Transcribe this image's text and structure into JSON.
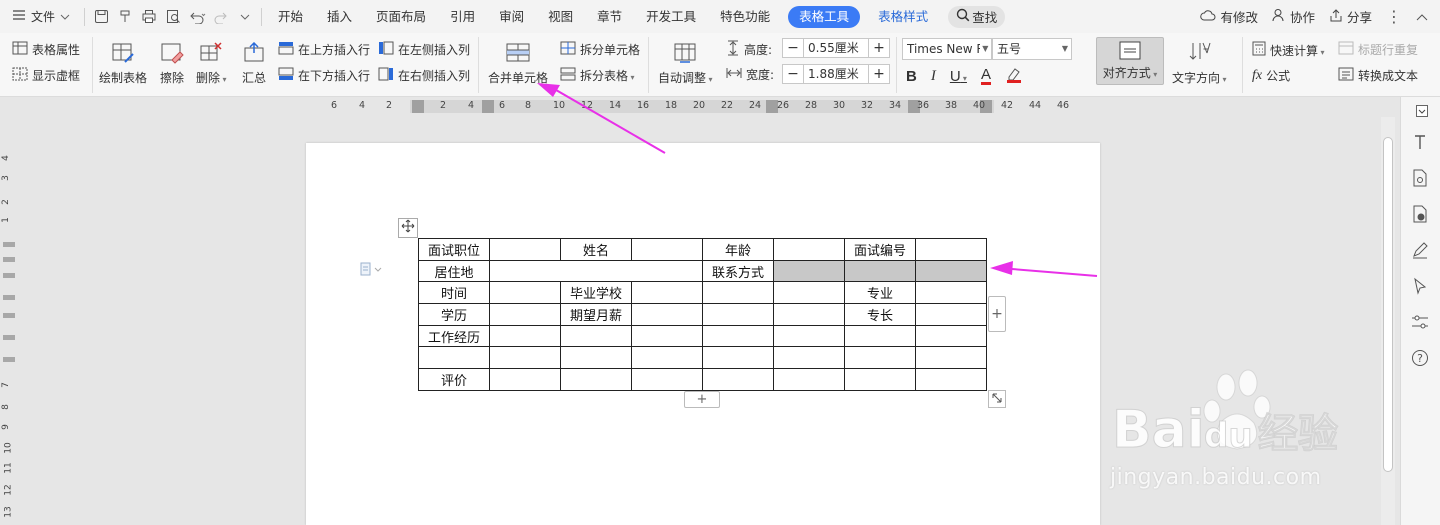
{
  "menubar": {
    "file_label": "文件",
    "tabs": [
      "开始",
      "插入",
      "页面布局",
      "引用",
      "审阅",
      "视图",
      "章节",
      "开发工具",
      "特色功能"
    ],
    "active_tab": "表格工具",
    "tab_style": "表格样式",
    "search_label": "查找",
    "right": {
      "modified": "有修改",
      "collab": "协作",
      "share": "分享"
    }
  },
  "ribbon": {
    "table_props": "表格属性",
    "show_grid": "显示虚框",
    "draw_table": "绘制表格",
    "erase": "擦除",
    "delete": "删除",
    "summary": "汇总",
    "insert_above": "在上方插入行",
    "insert_below": "在下方插入行",
    "insert_left": "在左侧插入列",
    "insert_right": "在右侧插入列",
    "merge_cells": "合并单元格",
    "split_cells": "拆分单元格",
    "split_table": "拆分表格",
    "auto_adjust": "自动调整",
    "height_label": "高度:",
    "height_value": "0.55厘米",
    "width_label": "宽度:",
    "width_value": "1.88厘米",
    "font_name": "Times New R",
    "font_size": "五号",
    "align": "对齐方式",
    "text_direction": "文字方向",
    "quick_calc": "快速计算",
    "repeat_header": "标题行重复",
    "formula": "公式",
    "to_text": "转换成文本"
  },
  "ruler": {
    "ticks": [
      "6",
      "4",
      "2",
      "2",
      "4",
      "6",
      "8",
      "10",
      "12",
      "14",
      "16",
      "18",
      "20",
      "22",
      "24",
      "26",
      "28",
      "30",
      "32",
      "34",
      "36",
      "38",
      "40",
      "42",
      "44",
      "46"
    ],
    "vticks": [
      "4",
      "3",
      "2",
      "1",
      "7",
      "8",
      "9",
      "10",
      "11",
      "12",
      "13"
    ]
  },
  "table": {
    "rows": [
      [
        "面试职位",
        "",
        "姓名",
        "",
        "年龄",
        "",
        "面试编号",
        ""
      ],
      [
        "居住地",
        "",
        "",
        "",
        "联系方式",
        "",
        "",
        ""
      ],
      [
        "时间",
        "",
        "毕业学校",
        "",
        "",
        "",
        "专业",
        ""
      ],
      [
        "学历",
        "",
        "期望月薪",
        "",
        "",
        "",
        "专长",
        ""
      ],
      [
        "工作经历",
        "",
        "",
        "",
        "",
        "",
        "",
        ""
      ],
      [
        "",
        "",
        "",
        "",
        "",
        "",
        "",
        ""
      ],
      [
        "评价",
        "",
        "",
        "",
        "",
        "",
        "",
        ""
      ]
    ]
  },
  "watermark": {
    "url": "jingyan.baidu.com"
  },
  "colors": {
    "accent": "#3b7bf5",
    "arrow": "#e830e8",
    "selection": "#c8c8c8"
  },
  "icons": [
    "menu-icon",
    "save-icon",
    "undo-icon",
    "redo-icon",
    "print-icon",
    "preview-icon",
    "search-icon",
    "move-icon",
    "plus-icon",
    "resize-icon"
  ]
}
